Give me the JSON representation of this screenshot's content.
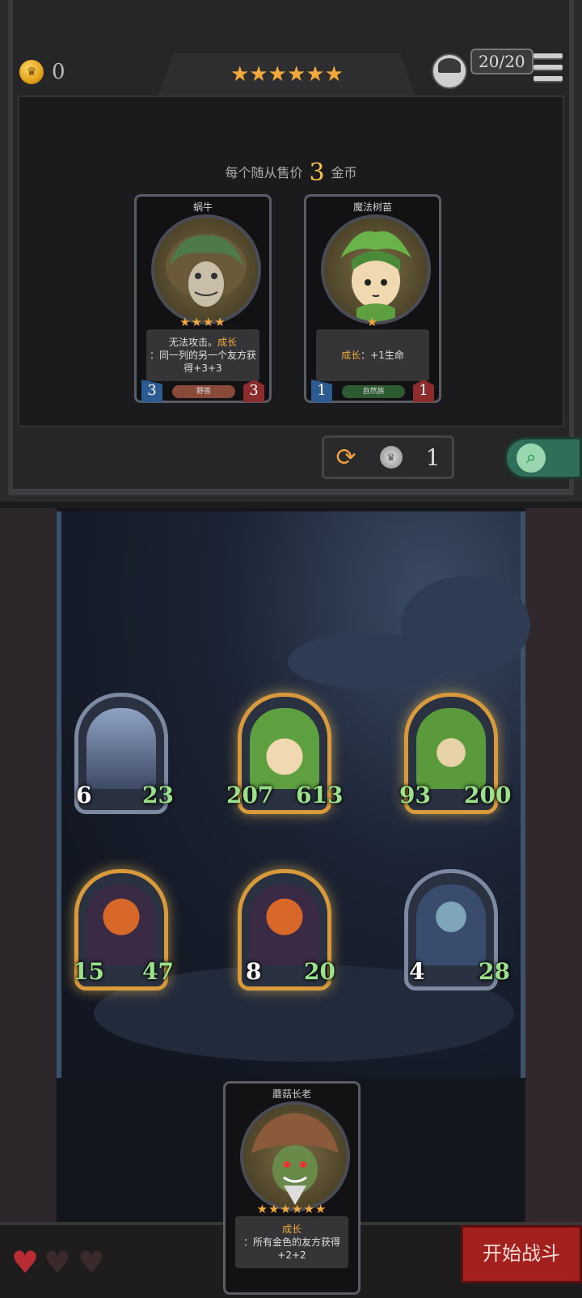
{
  "top_bar": {
    "gold": "0",
    "tier_stars": "★★★★★★",
    "minion_count": "20/20"
  },
  "shop": {
    "price_prefix": "每个随从售价",
    "price_value": "3",
    "price_suffix": "金币",
    "cards": [
      {
        "name": "蜗牛",
        "stars": "★★★★",
        "text_kw": "成长",
        "text_pre": "无法攻击。",
        "text_post": "：同一列的另一个友方获得+3+3",
        "attack": "3",
        "health": "3",
        "tribe": "野兽",
        "tribe_color": "#8a4a3a"
      },
      {
        "name": "魔法树苗",
        "stars": "★",
        "text_kw": "成长",
        "text_pre": "",
        "text_post": "：+1生命",
        "attack": "1",
        "health": "1",
        "tribe": "自然族",
        "tribe_color": "#2e5a32"
      }
    ],
    "refresh_icon": "refresh-icon",
    "refresh_cost": "1",
    "search_icon": "search-icon"
  },
  "board": {
    "minions": [
      {
        "name": "shadow-dragon",
        "attack": "6",
        "health": "23",
        "attack_buffed": false,
        "health_buffed": true,
        "frame": "silver"
      },
      {
        "name": "magic-sapling",
        "attack": "207",
        "health": "613",
        "attack_buffed": true,
        "health_buffed": true,
        "frame": "gold"
      },
      {
        "name": "treant-elder",
        "attack": "93",
        "health": "200",
        "attack_buffed": true,
        "health_buffed": true,
        "frame": "gold"
      },
      {
        "name": "pumpkin-lord",
        "attack": "15",
        "health": "47",
        "attack_buffed": true,
        "health_buffed": true,
        "frame": "gold"
      },
      {
        "name": "pumpkin-lord-2",
        "attack": "8",
        "health": "20",
        "attack_buffed": false,
        "health_buffed": true,
        "frame": "gold"
      },
      {
        "name": "sea-witch",
        "attack": "4",
        "health": "28",
        "attack_buffed": false,
        "health_buffed": true,
        "frame": "silver"
      }
    ]
  },
  "hand": {
    "card": {
      "name": "蘑菇长老",
      "stars": "★★★★★★",
      "text_kw": "成长",
      "text_post": "：所有金色的友方获得+2+2"
    }
  },
  "bottom": {
    "lives_full": 1,
    "lives_total": 3,
    "start_button": "开始战斗"
  }
}
